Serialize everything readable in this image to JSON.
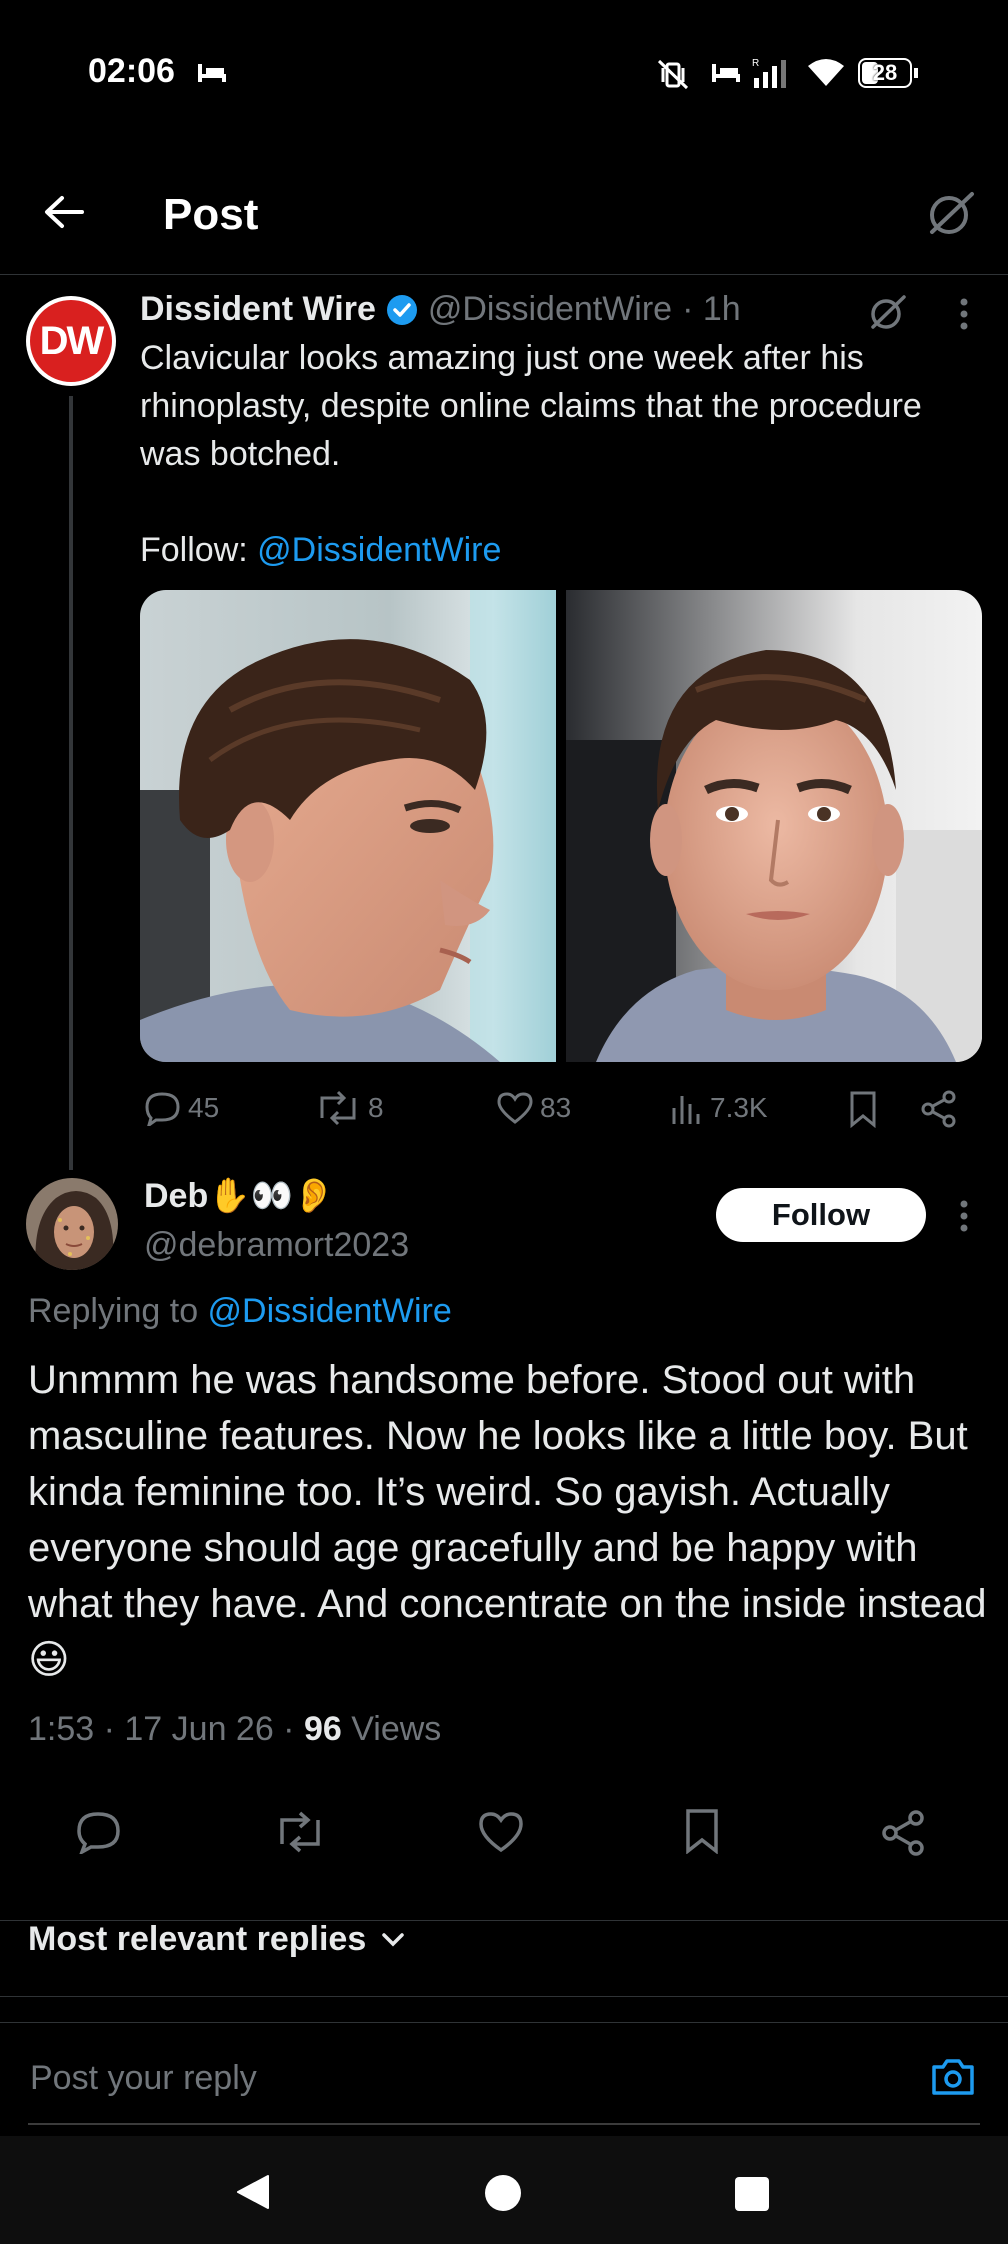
{
  "status_bar": {
    "time": "02:06",
    "battery": "28",
    "icons": [
      "hotel-icon",
      "mute-vibrate-icon",
      "hotel-icon",
      "signal-icon",
      "wifi-icon",
      "battery-icon"
    ]
  },
  "header": {
    "title": "Post",
    "back_icon": "arrow-left-icon",
    "grok_icon": "grok-icon"
  },
  "original_post": {
    "avatar_text": "DW",
    "display_name": "Dissident Wire",
    "verified": true,
    "handle": "@DissidentWire",
    "time": "· 1h",
    "text": "Clavicular looks amazing just one week after his rhinoplasty, despite online claims that the procedure was botched.",
    "follow_prefix": "Follow: ",
    "follow_handle": "@DissidentWire",
    "stats": {
      "replies": "45",
      "reposts": "8",
      "likes": "83",
      "views": "7.3K"
    }
  },
  "reply_post": {
    "display_name": "Deb✋👀👂",
    "handle": "@debramort2023",
    "follow_label": "Follow",
    "replying_prefix": "Replying to ",
    "replying_handle": "@DissidentWire",
    "text": "Unmmm he was handsome before. Stood out with masculine features. Now he looks like a little boy. But kinda feminine too. It’s weird. So gayish. Actually everyone should age gracefully and be happy with what they have. And concentrate on the inside instead 😃",
    "timestamp": "1:53 · 17 Jun 26 · ",
    "views_count": "96",
    "views_label": " Views"
  },
  "sort": {
    "label": "Most relevant replies"
  },
  "composer": {
    "placeholder": "Post your reply"
  },
  "colors": {
    "background": "#000000",
    "accent": "#1d9bf0",
    "muted": "#71767b",
    "dw_red": "#d9201f"
  }
}
